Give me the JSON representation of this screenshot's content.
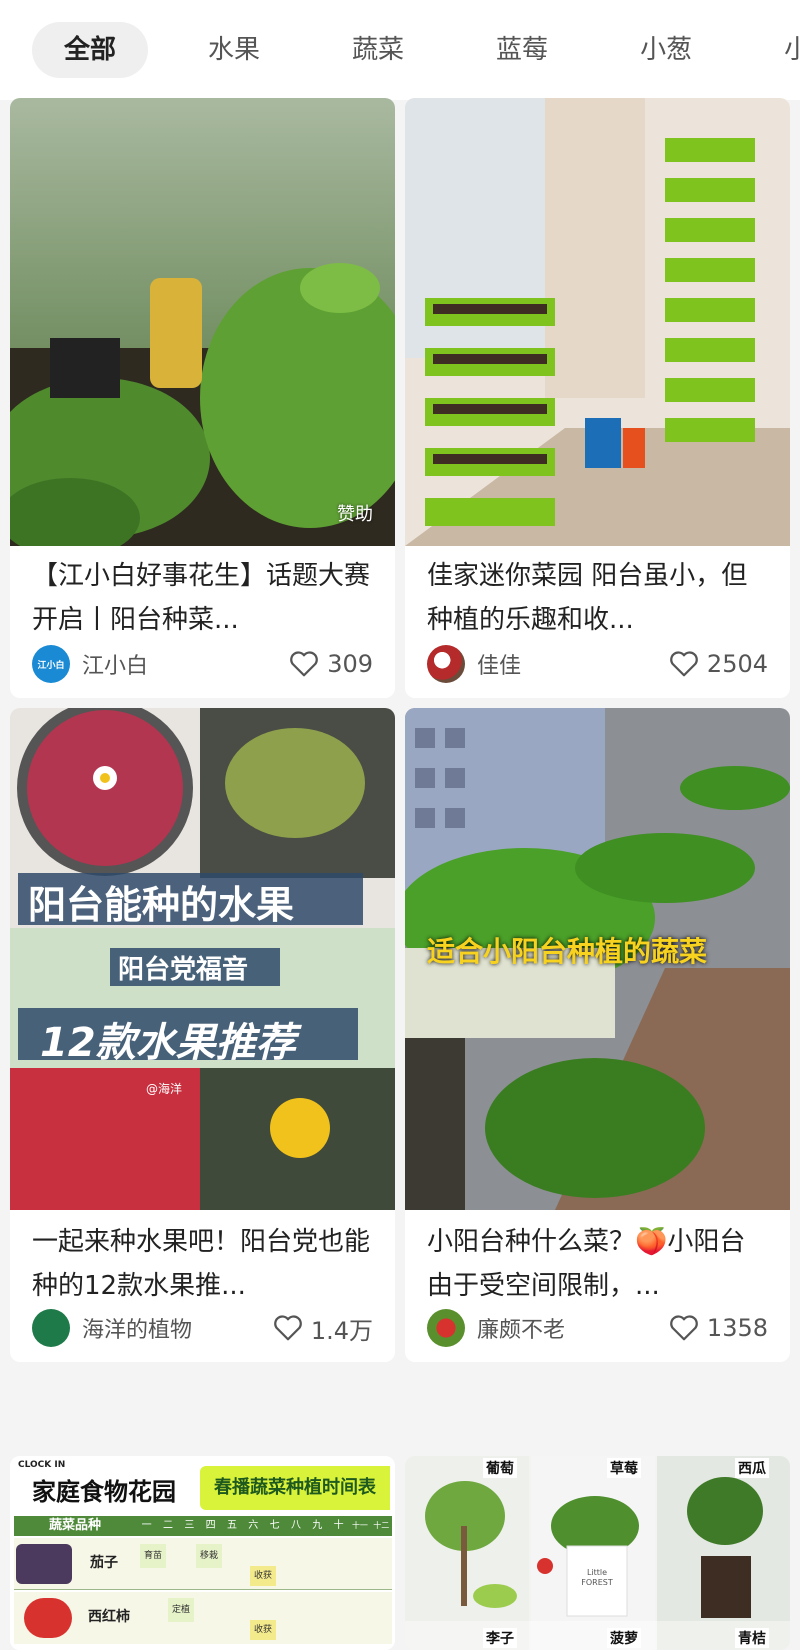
{
  "tabs": [
    "全部",
    "水果",
    "蔬菜",
    "蓝莓",
    "小葱",
    "小"
  ],
  "cards": [
    {
      "title": "【江小白好事花生】话题大赛开启丨阳台种菜...",
      "author": "江小白",
      "avatar_text": "江小白",
      "likes": "309",
      "badge": "赞助"
    },
    {
      "title": "佳家迷你菜园 阳台虽小，但种植的乐趣和收...",
      "author": "佳佳",
      "likes": "2504"
    },
    {
      "title": "一起来种水果吧！阳台党也能种的12款水果推...",
      "author": "海洋的植物",
      "likes": "1.4万",
      "overlay": {
        "line1": "阳台能种的水果",
        "line2": "阳台党福音",
        "line3": "12款水果推荐",
        "watermark": "@海洋"
      }
    },
    {
      "title": "小阳台种什么菜？🍑小阳台由于受空间限制，...",
      "author": "廉颇不老",
      "likes": "1358",
      "overlay": {
        "line1": "适合小阳台种植的蔬菜"
      }
    },
    {
      "overlay": {
        "clock": "CLOCK IN",
        "title": "家庭食物花园",
        "banner": "春播蔬菜种植时间表",
        "col_header": "蔬菜品种",
        "months": [
          "一",
          "二",
          "三",
          "四",
          "五",
          "六",
          "七",
          "八",
          "九",
          "十",
          "十一",
          "十二"
        ],
        "rows": [
          "茄子",
          "西红柿"
        ],
        "cells": [
          "育苗",
          "移栽",
          "定植",
          "收获"
        ]
      }
    },
    {
      "overlay": {
        "labels": [
          "葡萄",
          "草莓",
          "西瓜",
          "李子",
          "菠萝",
          "青桔"
        ],
        "pot_text": "Little FOREST"
      }
    }
  ],
  "colors": {
    "accent_green": "#7fc41e",
    "like_icon": "#555555",
    "active_tab_bg": "#efefef"
  }
}
